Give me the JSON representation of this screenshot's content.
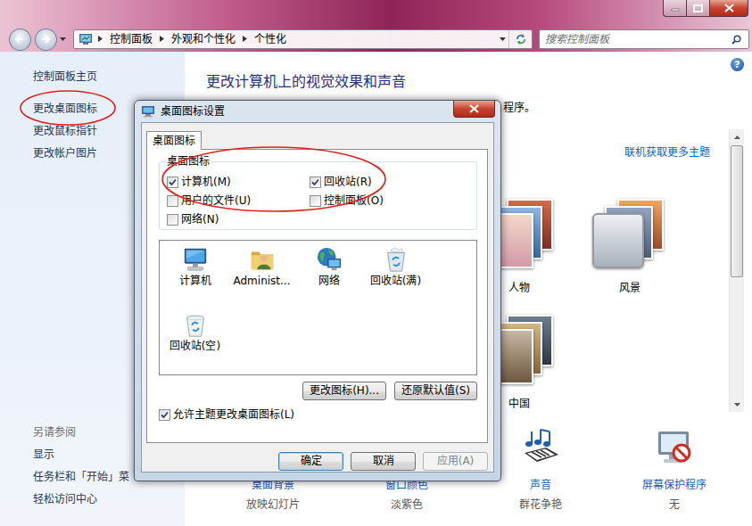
{
  "window": {
    "help": "?"
  },
  "address_bar": {
    "breadcrumbs": [
      "控制面板",
      "外观和个性化",
      "个性化"
    ],
    "search": {
      "placeholder": "搜索控制面板"
    }
  },
  "sidebar": {
    "items": [
      "控制面板主页",
      "更改桌面图标",
      "更改鼠标指针",
      "更改帐户图片"
    ],
    "see_also": {
      "title": "另请参阅",
      "items": [
        "显示",
        "任务栏和「开始」菜",
        "轻松访问中心"
      ]
    }
  },
  "main": {
    "heading": "更改计算机上的视觉效果和声音",
    "description": "程序。",
    "online_link": "联机获取更多主题",
    "themes": [
      {
        "label": "人物"
      },
      {
        "label": "风景"
      },
      {
        "label": "中国"
      }
    ],
    "settings": [
      {
        "kind": "background",
        "label": "桌面背景",
        "value": "放映幻灯片"
      },
      {
        "kind": "color",
        "label": "窗口颜色",
        "value": "淡紫色"
      },
      {
        "kind": "sound",
        "label": "声音",
        "value": "群花争艳"
      },
      {
        "kind": "screensaver",
        "label": "屏幕保护程序",
        "value": "无"
      }
    ]
  },
  "dialog": {
    "title": "桌面图标设置",
    "tabs": [
      {
        "label": "桌面图标",
        "selected": true
      }
    ],
    "group": {
      "title": "桌面图标",
      "options": [
        {
          "label": "计算机(M)",
          "checked": true
        },
        {
          "label": "回收站(R)",
          "checked": true
        },
        {
          "label": "用户的文件(U)",
          "checked": false
        },
        {
          "label": "控制面板(O)",
          "checked": false
        },
        {
          "label": "网络(N)",
          "checked": false
        }
      ]
    },
    "icons": [
      {
        "kind": "computer",
        "label": "计算机"
      },
      {
        "kind": "user-folder",
        "label": "Administ..."
      },
      {
        "kind": "network",
        "label": "网络"
      },
      {
        "kind": "recycle-full",
        "label": "回收站(满)"
      },
      {
        "kind": "recycle-empty",
        "label": "回收站(空)"
      }
    ],
    "icon_buttons": [
      "更改图标(H)...",
      "还原默认值(S)"
    ],
    "allow_theme": {
      "label": "允许主题更改桌面图标(L)",
      "checked": true
    },
    "buttons": [
      {
        "label": "确定",
        "default": true,
        "disabled": false
      },
      {
        "label": "取消",
        "default": false,
        "disabled": false
      },
      {
        "label": "应用(A)",
        "default": false,
        "disabled": true
      }
    ]
  }
}
